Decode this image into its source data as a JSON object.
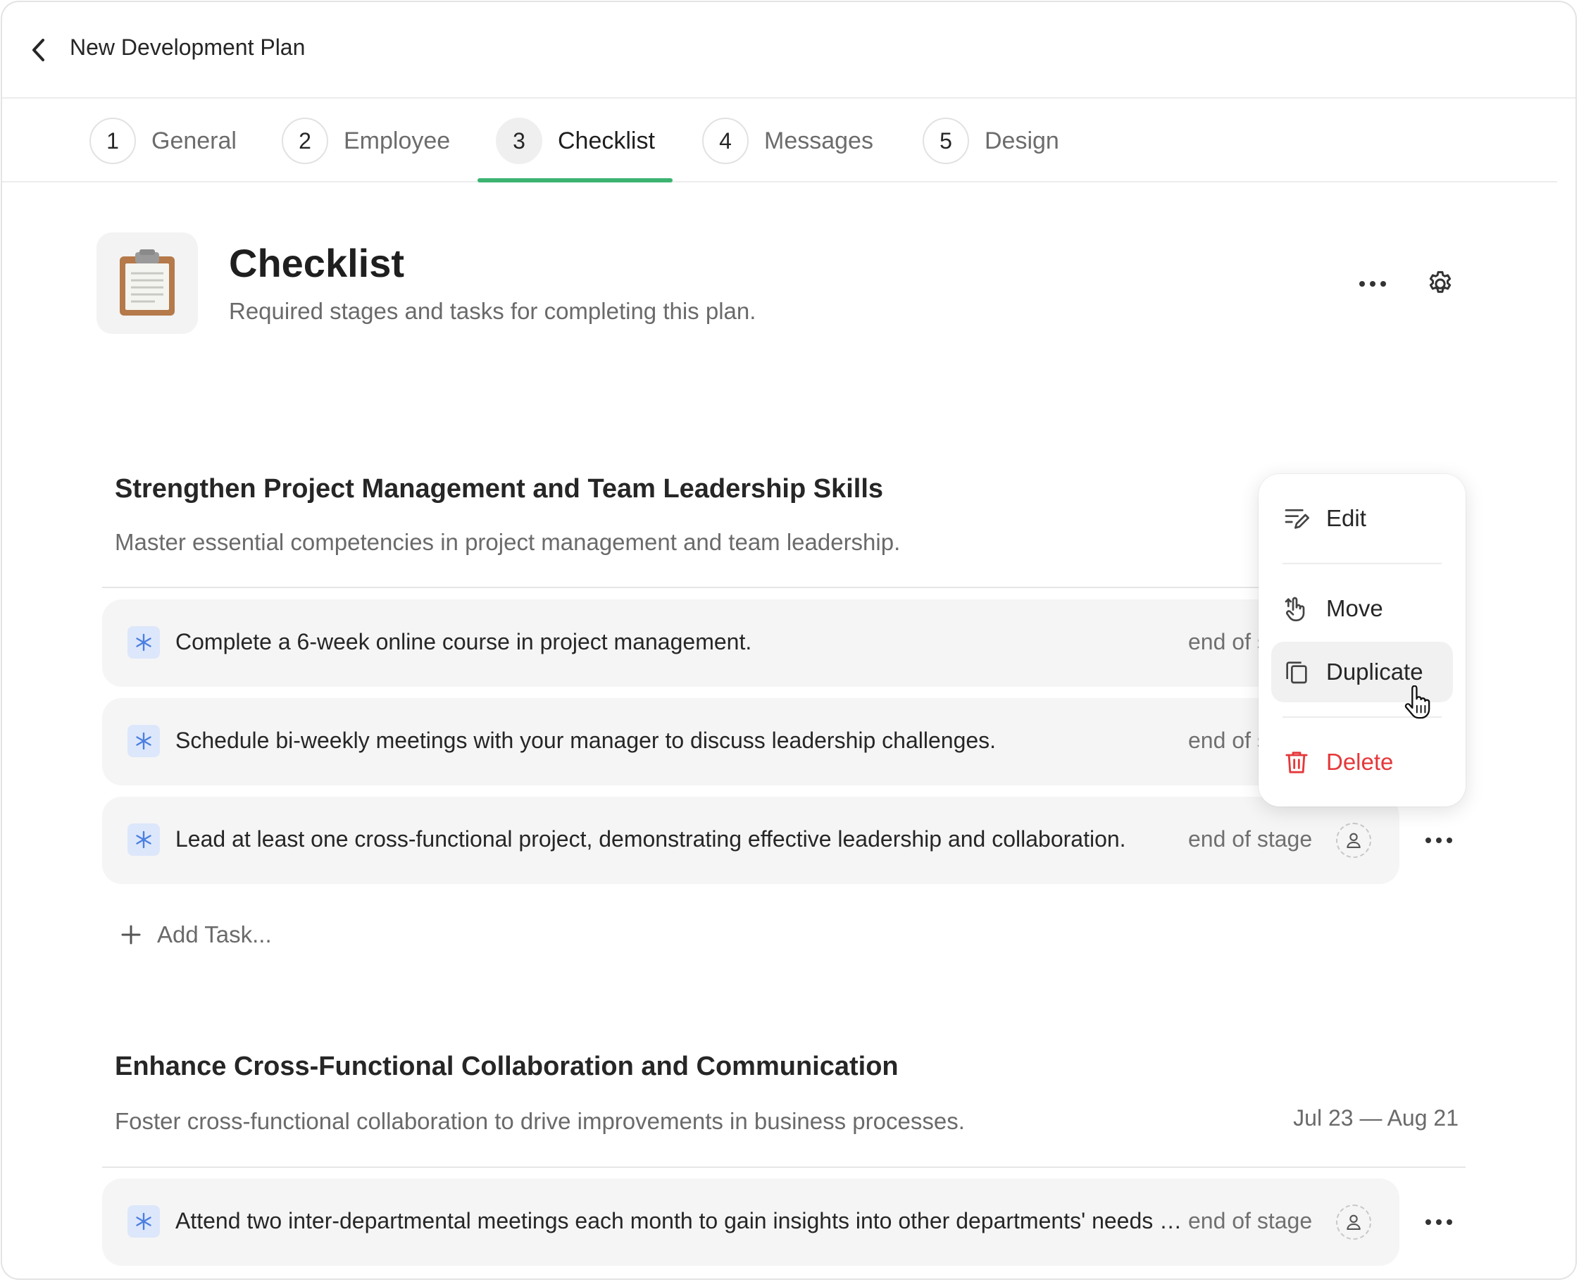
{
  "header": {
    "title": "New Development Plan"
  },
  "tabs": [
    {
      "num": "1",
      "label": "General"
    },
    {
      "num": "2",
      "label": "Employee"
    },
    {
      "num": "3",
      "label": "Checklist"
    },
    {
      "num": "4",
      "label": "Messages"
    },
    {
      "num": "5",
      "label": "Design"
    }
  ],
  "active_tab": "Checklist",
  "checklist": {
    "title": "Checklist",
    "subtitle": "Required stages and tasks for completing this plan."
  },
  "stages": [
    {
      "title": "Strengthen Project Management and Team Leadership Skills",
      "description": "Master essential competencies in project management and team leadership.",
      "tasks": [
        {
          "text": "Complete a 6-week online course in project management.",
          "due": "end of s"
        },
        {
          "text": "Schedule bi-weekly meetings with your manager to discuss leadership challenges.",
          "due": "end of s"
        },
        {
          "text": "Lead at least one cross-functional project, demonstrating effective leadership and collaboration.",
          "due": "end of stage"
        }
      ],
      "add_task_label": "Add Task..."
    },
    {
      "title": "Enhance Cross-Functional Collaboration and Communication",
      "description": "Foster cross-functional collaboration to drive improvements in business processes.",
      "dates": "Jul 23 — Aug 21",
      "tasks": [
        {
          "text": "Attend two inter-departmental meetings each month to gain insights into other departments' needs a...",
          "due": "end of stage"
        }
      ]
    }
  ],
  "context_menu": {
    "items": [
      {
        "label": "Edit",
        "icon": "edit-icon"
      },
      {
        "label": "Move",
        "icon": "move-hand-icon"
      },
      {
        "label": "Duplicate",
        "icon": "duplicate-icon"
      },
      {
        "label": "Delete",
        "icon": "trash-icon"
      }
    ],
    "hovered": "Duplicate"
  },
  "colors": {
    "accent": "#3cb371",
    "task_badge": "#dde7fb",
    "task_badge_icon": "#4a7fe0",
    "danger": "#e5383b"
  }
}
